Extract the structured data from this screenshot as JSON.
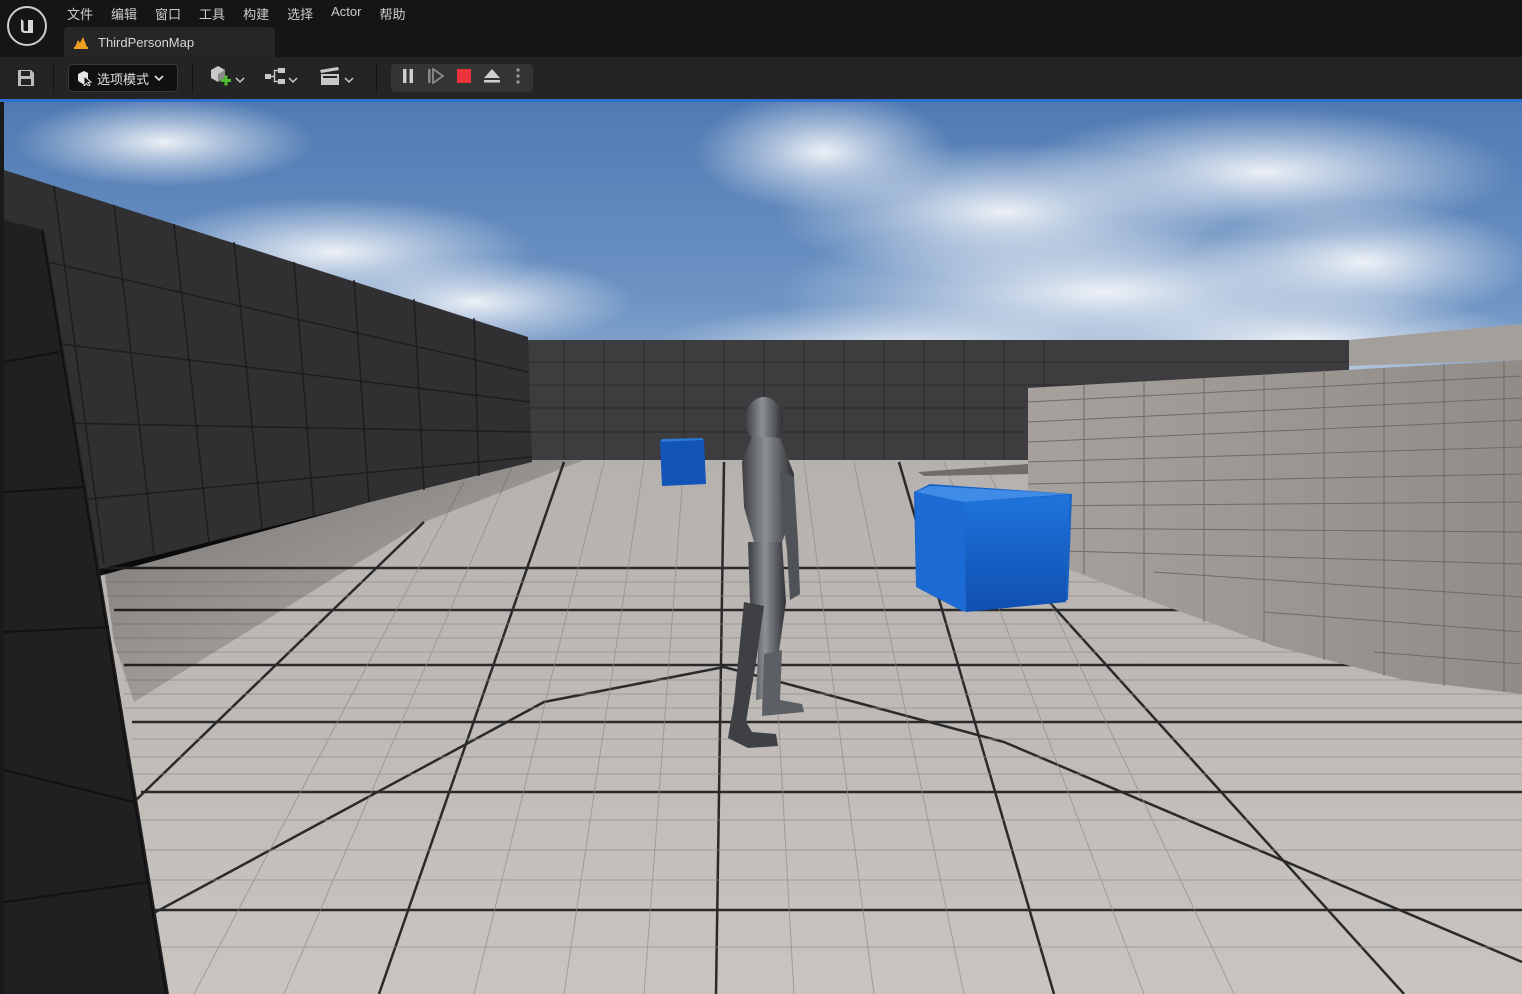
{
  "app": {
    "logo_icon": "unreal-engine-logo-icon"
  },
  "menu": {
    "items": [
      {
        "label": "文件"
      },
      {
        "label": "编辑"
      },
      {
        "label": "窗口"
      },
      {
        "label": "工具"
      },
      {
        "label": "构建"
      },
      {
        "label": "选择"
      },
      {
        "label": "Actor"
      },
      {
        "label": "帮助"
      }
    ]
  },
  "tab": {
    "label": "ThirdPersonMap",
    "icon": "level-map-icon"
  },
  "toolbar": {
    "save_icon": "save-icon",
    "mode_label": "选项模式",
    "mode_icon": "select-mode-icon",
    "add_actor_icon": "add-actor-icon",
    "blueprints_icon": "blueprint-icon",
    "cinematics_icon": "clapperboard-icon",
    "play_controls": {
      "pause_icon": "pause-icon",
      "step_icon": "frame-step-icon",
      "stop_icon": "stop-icon",
      "eject_icon": "eject-icon",
      "more_icon": "more-options-icon",
      "stop_color": "#e8343a"
    }
  },
  "viewport": {
    "scene": "third-person-level",
    "accent_color": "#2f6fd0",
    "cube_color": "#1565d0"
  }
}
